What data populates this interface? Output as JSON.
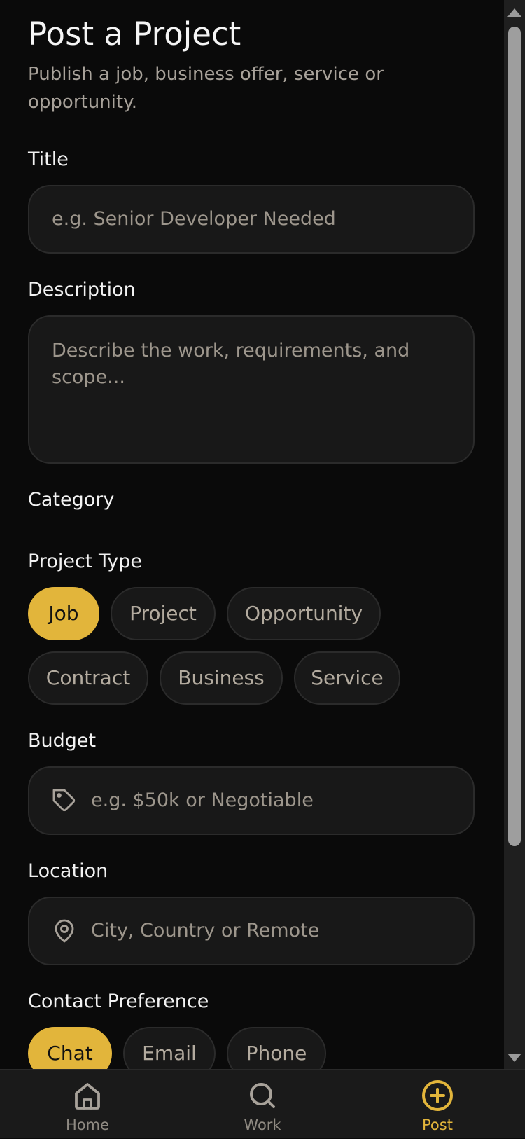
{
  "header": {
    "title": "Post a Project",
    "subtitle": "Publish a job, business offer, service or opportunity."
  },
  "form": {
    "title": {
      "label": "Title",
      "placeholder": "e.g. Senior Developer Needed"
    },
    "description": {
      "label": "Description",
      "placeholder": "Describe the work, requirements, and scope..."
    },
    "category": {
      "label": "Category"
    },
    "project_type": {
      "label": "Project Type",
      "options": [
        "Job",
        "Project",
        "Opportunity",
        "Contract",
        "Business",
        "Service"
      ],
      "selected": "Job"
    },
    "budget": {
      "label": "Budget",
      "placeholder": "e.g. $50k or Negotiable",
      "icon": "tag-icon"
    },
    "location": {
      "label": "Location",
      "placeholder": "City, Country or Remote",
      "icon": "map-pin-icon"
    },
    "contact_preference": {
      "label": "Contact Preference",
      "options": [
        "Chat",
        "Email",
        "Phone"
      ],
      "selected": "Chat"
    }
  },
  "bottom_nav": {
    "items": [
      {
        "label": "Home",
        "icon": "home-icon"
      },
      {
        "label": "Work",
        "icon": "search-icon"
      },
      {
        "label": "Post",
        "icon": "plus-circle-icon"
      }
    ],
    "active": "Post"
  },
  "colors": {
    "accent": "#e2b53b",
    "background": "#0a0a0a",
    "field_background": "#181818",
    "placeholder": "#9d968c"
  }
}
